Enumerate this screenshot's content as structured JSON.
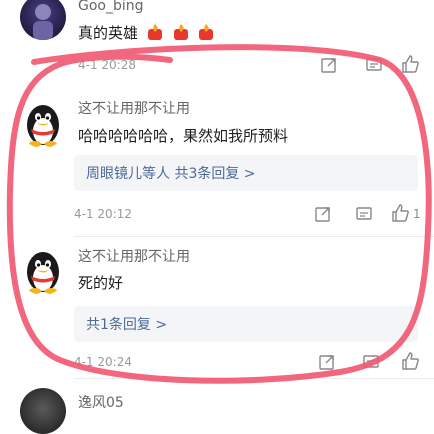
{
  "comments": [
    {
      "username": "Goo_bing",
      "text": "真的英雄",
      "emojis": [
        "fire-emoji",
        "fire-emoji",
        "fire-emoji"
      ],
      "timestamp": "4-1 20:28"
    },
    {
      "username": "这不让用那不让用",
      "text": "哈哈哈哈哈哈，果然如我所预料",
      "reply_summary": "周眼镜儿等人 共3条回复 >",
      "timestamp": "4-1 20:12",
      "like_count": "1"
    },
    {
      "username": "这不让用那不让用",
      "text": "死的好",
      "reply_summary": "共1条回复 >",
      "timestamp": "4-1 20:24"
    },
    {
      "username": "逸风05"
    }
  ],
  "icons": {
    "share": "share-icon",
    "comment": "comment-icon",
    "like": "thumbs-up-icon"
  },
  "colors": {
    "annotation_circle": "#f1576f",
    "reply_link": "#4b6a99",
    "meta_text": "#9a9a9a",
    "reply_box_bg": "#f4f5f7"
  }
}
